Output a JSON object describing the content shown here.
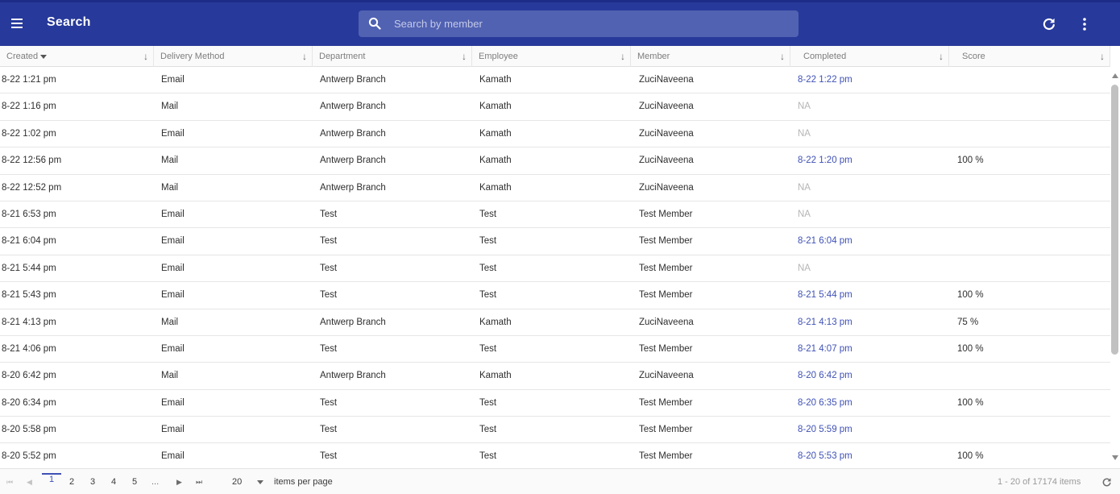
{
  "app": {
    "title": "Search",
    "search_placeholder": "Search by member",
    "search_value": ""
  },
  "icons": {
    "menu": "menu-icon",
    "search": "search-icon",
    "refresh": "refresh-icon",
    "more": "more-vert-icon"
  },
  "colors": {
    "appbar": "#27399a",
    "accent": "#3f51b5",
    "search_bg": "#5162b2",
    "muted": "#b5b5b5"
  },
  "table": {
    "columns": [
      {
        "label": "Created",
        "sorted": "desc"
      },
      {
        "label": "Delivery Method"
      },
      {
        "label": "Department"
      },
      {
        "label": "Employee"
      },
      {
        "label": "Member"
      },
      {
        "label": "Completed"
      },
      {
        "label": "Score"
      }
    ],
    "rows": [
      {
        "created": "8-22 1:21 pm",
        "delivery": "Email",
        "department": "Antwerp Branch",
        "employee": "Kamath",
        "member": "ZuciNaveena",
        "completed": "8-22 1:22 pm",
        "score": ""
      },
      {
        "created": "8-22 1:16 pm",
        "delivery": "Mail",
        "department": "Antwerp Branch",
        "employee": "Kamath",
        "member": "ZuciNaveena",
        "completed": "NA",
        "score": ""
      },
      {
        "created": "8-22 1:02 pm",
        "delivery": "Email",
        "department": "Antwerp Branch",
        "employee": "Kamath",
        "member": "ZuciNaveena",
        "completed": "NA",
        "score": ""
      },
      {
        "created": "8-22 12:56 pm",
        "delivery": "Mail",
        "department": "Antwerp Branch",
        "employee": "Kamath",
        "member": "ZuciNaveena",
        "completed": "8-22 1:20 pm",
        "score": "100 %"
      },
      {
        "created": "8-22 12:52 pm",
        "delivery": "Mail",
        "department": "Antwerp Branch",
        "employee": "Kamath",
        "member": "ZuciNaveena",
        "completed": "NA",
        "score": ""
      },
      {
        "created": "8-21 6:53 pm",
        "delivery": "Email",
        "department": "Test",
        "employee": "Test",
        "member": "Test Member",
        "completed": "NA",
        "score": ""
      },
      {
        "created": "8-21 6:04 pm",
        "delivery": "Email",
        "department": "Test",
        "employee": "Test",
        "member": "Test Member",
        "completed": "8-21 6:04 pm",
        "score": ""
      },
      {
        "created": "8-21 5:44 pm",
        "delivery": "Email",
        "department": "Test",
        "employee": "Test",
        "member": "Test Member",
        "completed": "NA",
        "score": ""
      },
      {
        "created": "8-21 5:43 pm",
        "delivery": "Email",
        "department": "Test",
        "employee": "Test",
        "member": "Test Member",
        "completed": "8-21 5:44 pm",
        "score": "100 %"
      },
      {
        "created": "8-21 4:13 pm",
        "delivery": "Mail",
        "department": "Antwerp Branch",
        "employee": "Kamath",
        "member": "ZuciNaveena",
        "completed": "8-21 4:13 pm",
        "score": "75 %"
      },
      {
        "created": "8-21 4:06 pm",
        "delivery": "Email",
        "department": "Test",
        "employee": "Test",
        "member": "Test Member",
        "completed": "8-21 4:07 pm",
        "score": "100 %"
      },
      {
        "created": "8-20 6:42 pm",
        "delivery": "Mail",
        "department": "Antwerp Branch",
        "employee": "Kamath",
        "member": "ZuciNaveena",
        "completed": "8-20 6:42 pm",
        "score": ""
      },
      {
        "created": "8-20 6:34 pm",
        "delivery": "Email",
        "department": "Test",
        "employee": "Test",
        "member": "Test Member",
        "completed": "8-20 6:35 pm",
        "score": "100 %"
      },
      {
        "created": "8-20 5:58 pm",
        "delivery": "Email",
        "department": "Test",
        "employee": "Test",
        "member": "Test Member",
        "completed": "8-20 5:59 pm",
        "score": ""
      },
      {
        "created": "8-20 5:52 pm",
        "delivery": "Email",
        "department": "Test",
        "employee": "Test",
        "member": "Test Member",
        "completed": "8-20 5:53 pm",
        "score": "100 %"
      }
    ]
  },
  "pager": {
    "pages": [
      "1",
      "2",
      "3",
      "4",
      "5",
      "..."
    ],
    "current_page": "1",
    "page_size": "20",
    "items_per_page_label": "items per page",
    "info": "1 - 20 of 17174 items"
  }
}
